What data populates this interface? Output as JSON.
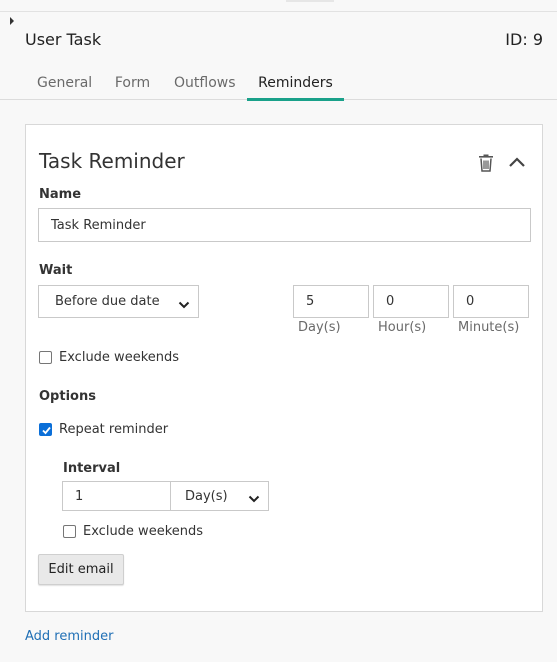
{
  "header": {
    "title": "User Task",
    "id_label": "ID: 9"
  },
  "tabs": [
    {
      "label": "General"
    },
    {
      "label": "Form"
    },
    {
      "label": "Outflows"
    },
    {
      "label": "Reminders"
    }
  ],
  "active_tab": "Reminders",
  "accent_color": "#1aa18a",
  "reminder": {
    "title": "Task Reminder",
    "name_label": "Name",
    "name_value": "Task Reminder",
    "wait_label": "Wait",
    "wait_select": "Before due date",
    "days_value": "5",
    "hours_value": "0",
    "minutes_value": "0",
    "days_unit": "Day(s)",
    "hours_unit": "Hour(s)",
    "minutes_unit": "Minute(s)",
    "exclude_weekends_label": "Exclude weekends",
    "exclude_weekends_checked": false,
    "options_label": "Options",
    "repeat_label": "Repeat reminder",
    "repeat_checked": true,
    "interval_label": "Interval",
    "interval_value": "1",
    "interval_unit": "Day(s)",
    "interval_exclude_label": "Exclude weekends",
    "interval_exclude_checked": false,
    "edit_email_label": "Edit email"
  },
  "add_reminder_label": "Add reminder",
  "icons": {
    "trash": "trash-icon",
    "collapse": "chevron-up-icon",
    "expand": "caret-right-icon",
    "dropdown": "chevron-down-icon"
  }
}
